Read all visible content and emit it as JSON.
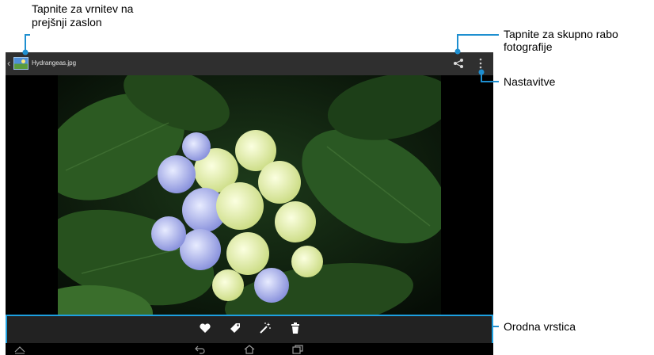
{
  "annotations": {
    "back": {
      "line1": "Tapnite za vrnitev na",
      "line2": "prejšnji zaslon"
    },
    "share": {
      "line1": "Tapnite za skupno rabo",
      "line2": "fotografije"
    },
    "settings": "Nastavitve",
    "context_bar": "Orodna vrstica"
  },
  "action_bar": {
    "filename": "Hydrangeas.jpg",
    "back_icon": "chevron-left-icon",
    "share_icon": "share-icon",
    "overflow_icon": "overflow-menu-icon"
  },
  "context_bar": {
    "icons": [
      "heart-icon",
      "tag-icon",
      "magic-wand-icon",
      "trash-icon"
    ]
  },
  "system_nav": {
    "icons": [
      "recent-up-icon",
      "back-nav-icon",
      "home-nav-icon",
      "recent-apps-icon"
    ]
  },
  "colors": {
    "accent": "#1da0e0",
    "action_bar_bg": "#2f2f2f",
    "context_bar_bg": "#222222",
    "callout_line": "#1e8fd0"
  }
}
